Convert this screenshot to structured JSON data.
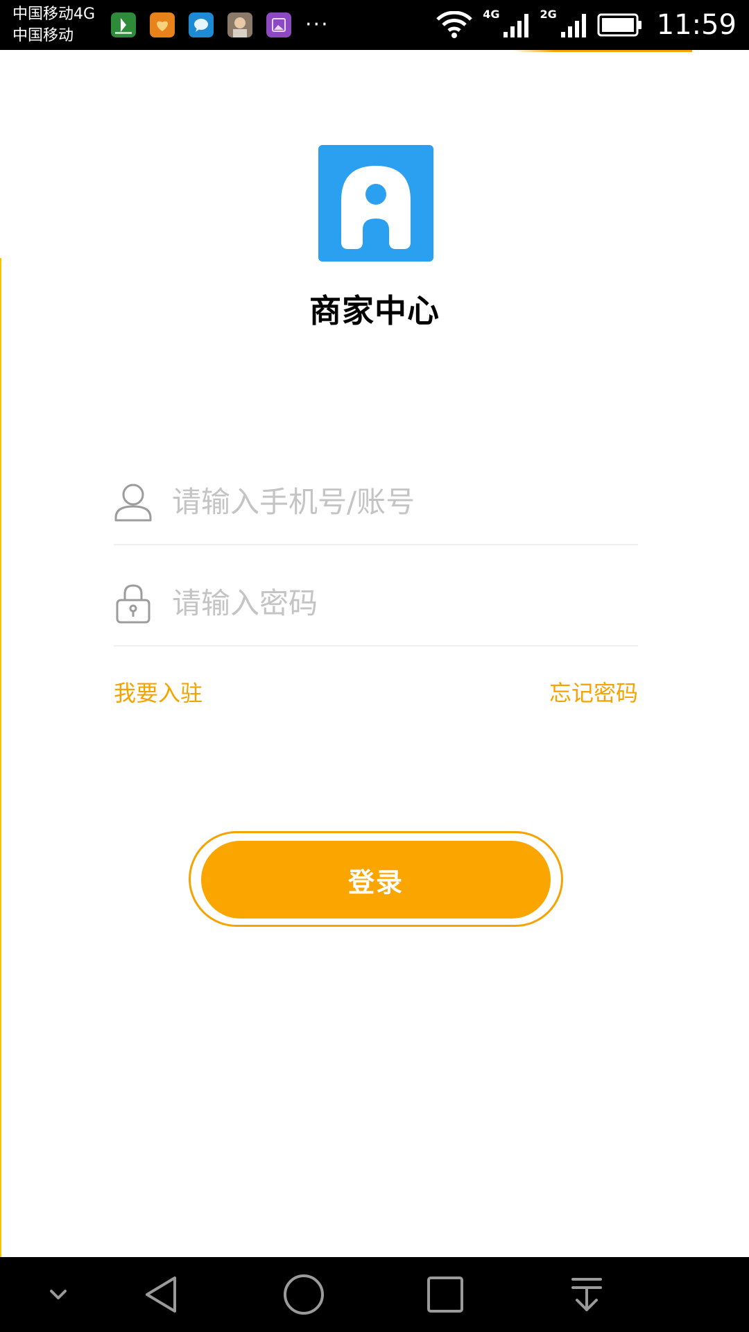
{
  "status_bar": {
    "carrier_primary": "中国移动4G",
    "carrier_secondary": "中国移动",
    "notification_icons": [
      "maps-app-icon",
      "health-app-icon",
      "chat-app-icon",
      "photo-contact-icon",
      "gallery-app-icon"
    ],
    "more_indicator": "···",
    "network_1": "4G",
    "network_2": "2G",
    "time": "11:59"
  },
  "app": {
    "title": "商家中心",
    "logo_color": "#2ba0f0"
  },
  "form": {
    "account_placeholder": "请输入手机号/账号",
    "account_value": "",
    "password_placeholder": "请输入密码",
    "password_value": "",
    "join_link": "我要入驻",
    "forgot_link": "忘记密码",
    "login_label": "登录"
  },
  "colors": {
    "accent": "#f5a300",
    "button": "#fba500",
    "placeholder": "#c4c4c4"
  },
  "nav_bar": {
    "buttons": [
      "collapse-icon",
      "back-icon",
      "home-icon",
      "recents-icon",
      "notification-pull-icon"
    ]
  }
}
